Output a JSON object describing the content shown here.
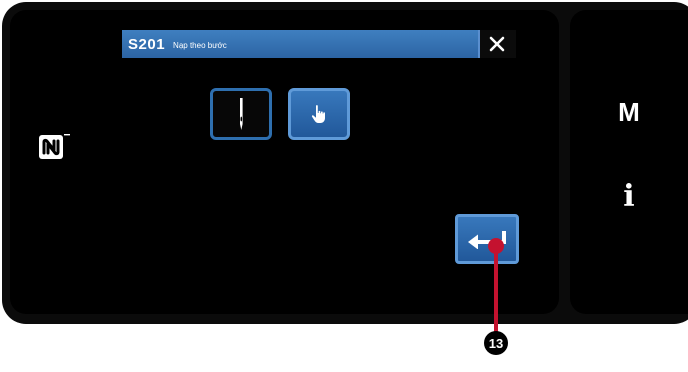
{
  "dialog": {
    "code": "S201",
    "title": "Nạp theo bước",
    "close_icon": "close-icon"
  },
  "mode_buttons": [
    {
      "icon": "needle-icon",
      "selected": false
    },
    {
      "icon": "hand-pointer-icon",
      "selected": true
    }
  ],
  "enter_button": {
    "icon": "enter-icon"
  },
  "nfc": {
    "icon": "nfc-n-mark-icon"
  },
  "side_panel": {
    "m_label": "M",
    "info_label": "i"
  },
  "callout": {
    "number": "13"
  },
  "colors": {
    "accent": "#2e6faf",
    "selected_button": "#2c64a4",
    "callout": "#c4122f",
    "background": "#000000"
  }
}
